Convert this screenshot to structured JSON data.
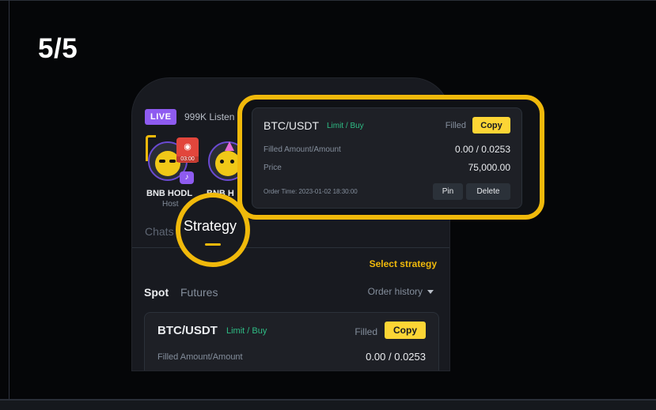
{
  "step_indicator": "5/5",
  "room": {
    "live_label": "LIVE",
    "listeners": "999K Listen",
    "hosts": [
      {
        "name": "BNB HODL",
        "role": "Host",
        "badge_time": "03:00"
      },
      {
        "name": "BNB H"
      }
    ]
  },
  "tabs": {
    "chats": "Chats",
    "strategy": "Strategy"
  },
  "strategy_panel": {
    "select_strategy": "Select strategy",
    "spot": "Spot",
    "futures": "Futures",
    "order_history": "Order history"
  },
  "order": {
    "pair": "BTC/USDT",
    "type": "Limit / Buy",
    "status": "Filled",
    "copy": "Copy",
    "filled_label": "Filled Amount/Amount",
    "filled_value": "0.00 / 0.0253",
    "price_label": "Price",
    "price_value": "75,000.00",
    "order_time": "Order Time: 2023-01-02 18:30:00",
    "pin": "Pin",
    "delete": "Delete"
  },
  "colors": {
    "accent": "#f0b90b",
    "copy_button": "#fcd535",
    "buy_green": "#2ebd85",
    "live_purple": "#8e5bf0"
  }
}
